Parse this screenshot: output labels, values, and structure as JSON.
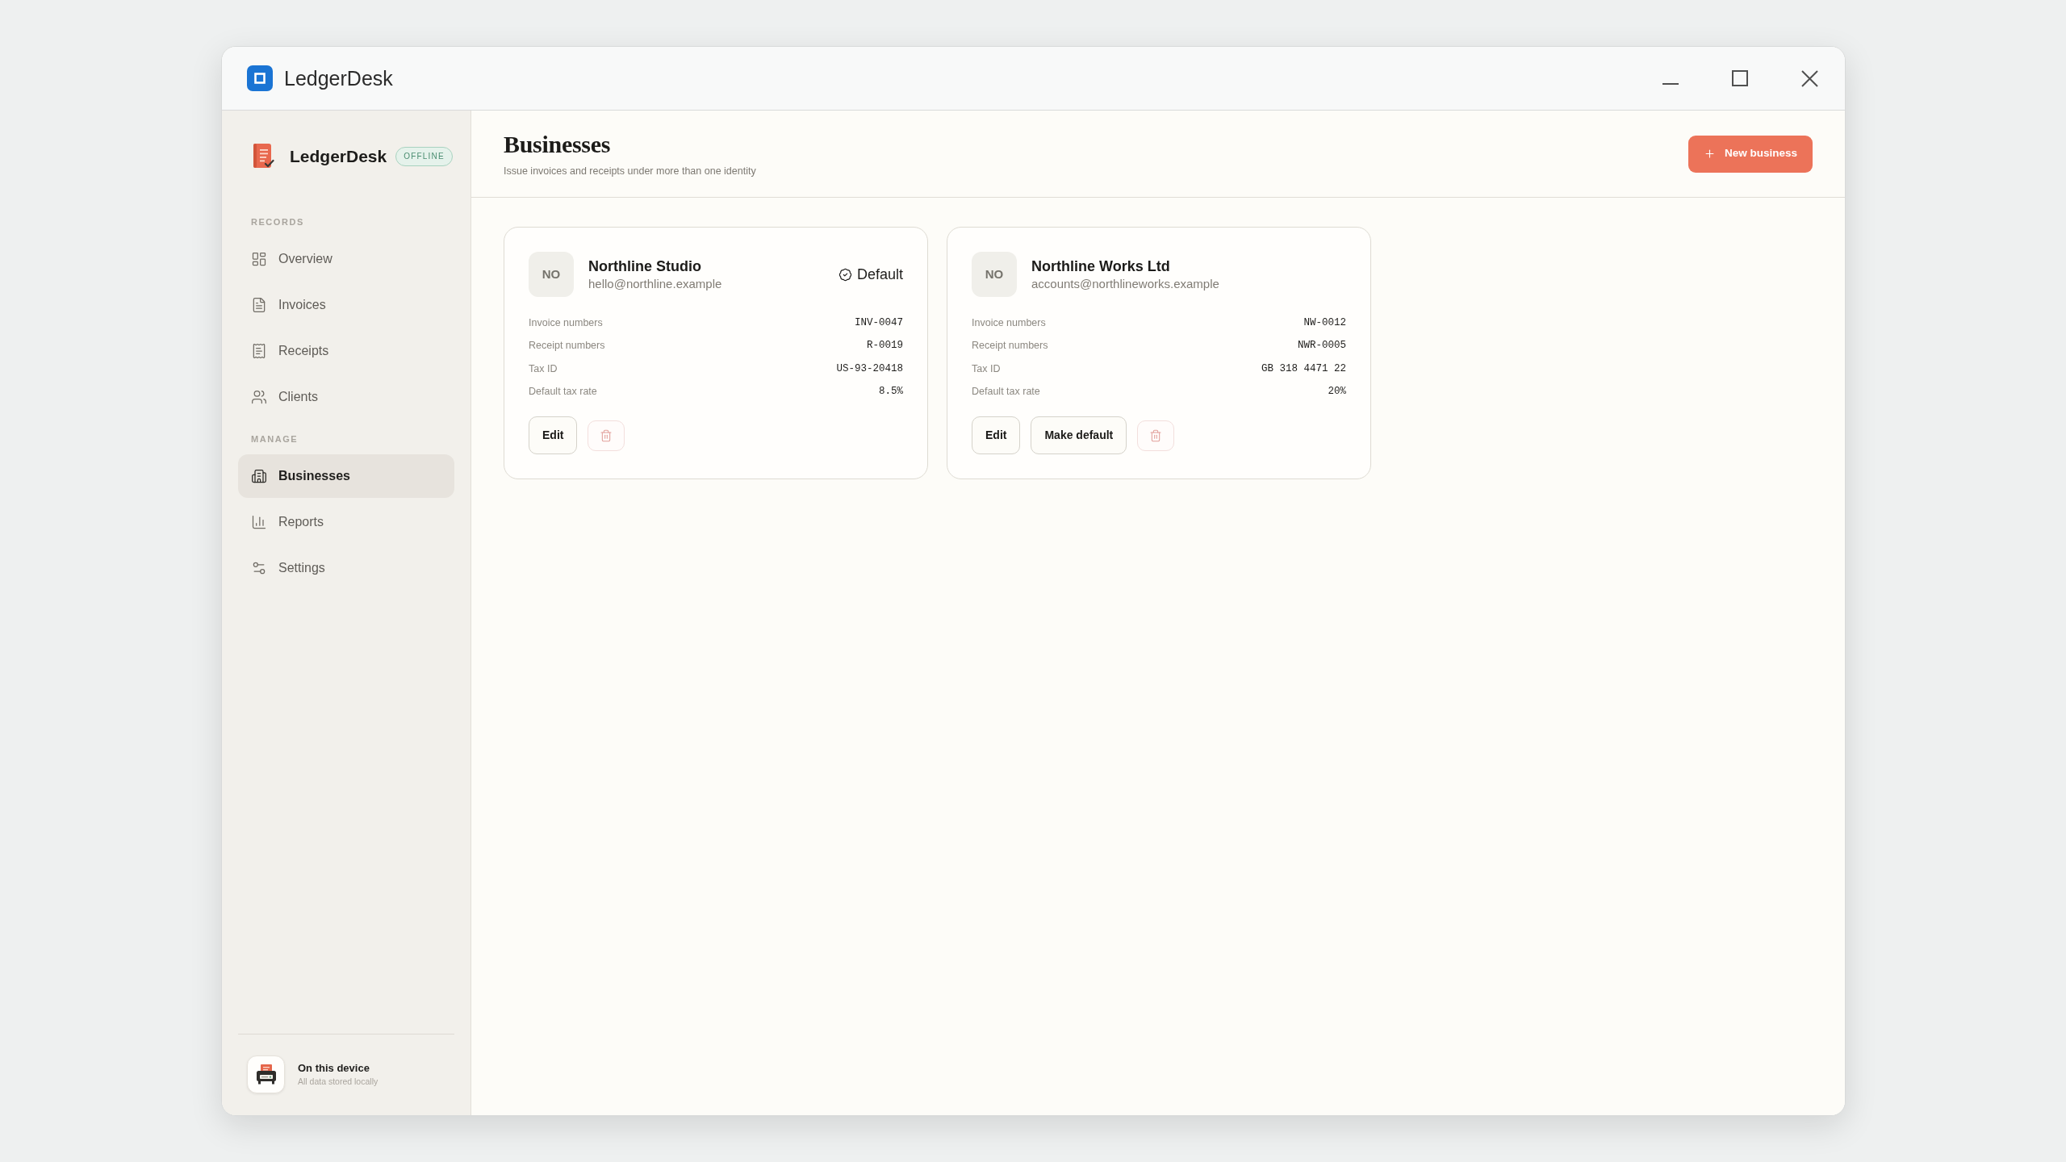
{
  "window": {
    "title": "LedgerDesk"
  },
  "sidebar": {
    "brand": "LedgerDesk",
    "badge": "OFFLINE",
    "sections": [
      {
        "heading": "RECORDS",
        "items": [
          {
            "label": "Overview",
            "selected": false
          },
          {
            "label": "Invoices",
            "selected": false
          },
          {
            "label": "Receipts",
            "selected": false
          },
          {
            "label": "Clients",
            "selected": false
          }
        ]
      },
      {
        "heading": "MANAGE",
        "items": [
          {
            "label": "Businesses",
            "selected": true
          },
          {
            "label": "Reports",
            "selected": false
          },
          {
            "label": "Settings",
            "selected": false
          }
        ]
      }
    ],
    "footer": {
      "title": "On this device",
      "subtitle": "All data stored locally"
    }
  },
  "header": {
    "title": "Businesses",
    "subtitle": "Issue invoices and receipts under more than one identity",
    "new_button": "New business"
  },
  "businesses": [
    {
      "initials": "NO",
      "name": "Northline Studio",
      "email": "hello@northline.example",
      "default": true,
      "default_label": "Default",
      "fields": [
        {
          "label": "Invoice numbers",
          "value": "INV-0047"
        },
        {
          "label": "Receipt numbers",
          "value": "R-0019"
        },
        {
          "label": "Tax ID",
          "value": "US-93-20418"
        },
        {
          "label": "Default tax rate",
          "value": "8.5%"
        }
      ],
      "buttons": [
        {
          "kind": "edit",
          "label": "Edit"
        },
        {
          "kind": "delete"
        }
      ]
    },
    {
      "initials": "NO",
      "name": "Northline Works Ltd",
      "email": "accounts@northlineworks.example",
      "default": false,
      "fields": [
        {
          "label": "Invoice numbers",
          "value": "NW-0012"
        },
        {
          "label": "Receipt numbers",
          "value": "NWR-0005"
        },
        {
          "label": "Tax ID",
          "value": "GB 318 4471 22"
        },
        {
          "label": "Default tax rate",
          "value": "20%"
        }
      ],
      "buttons": [
        {
          "kind": "edit",
          "label": "Edit"
        },
        {
          "kind": "make_default",
          "label": "Make default"
        },
        {
          "kind": "delete"
        }
      ]
    }
  ]
}
